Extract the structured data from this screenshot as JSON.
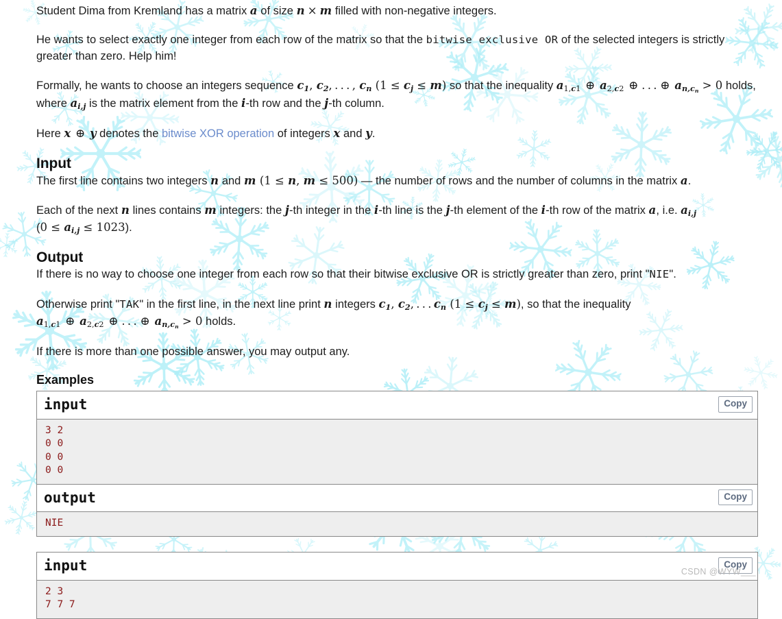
{
  "colors": {
    "link": "#6b8ccc",
    "code_text": "#8b1a1a",
    "code_bg": "#eeeeee",
    "box_border": "#888888",
    "snowflake": "#aeeef7",
    "watermark": "#b9b9b9"
  },
  "statement": {
    "p1": {
      "t1": "Student Dima from Kremland has a matrix ",
      "m1": "a",
      "t2": " of size ",
      "m2": "n",
      "m3": "×",
      "m4": "m",
      "t3": " filled with non-negative integers."
    },
    "p2": {
      "t1": "He wants to select exactly one integer from each row of the matrix so that the ",
      "code": "bitwise exclusive OR",
      "t2": " of the selected integers is strictly greater than zero. Help him!"
    },
    "p3": {
      "t1": "Formally, he wants to choose an integers sequence ",
      "seq": "c1, c2, . . . , cn",
      "range": "(1 ≤ cj ≤ m)",
      "t2": " so that the inequality ",
      "ineq": "a1,c1 ⊕ a2,c2 ⊕ . . . ⊕ an,cn > 0",
      "t3": " holds, where ",
      "m1": "ai,j",
      "t4": " is the matrix element from the ",
      "m2": "i",
      "t5": "-th row and the ",
      "m3": "j",
      "t6": "-th column."
    },
    "p4": {
      "t1": "Here ",
      "m1": "x ⊕ y",
      "t2": " denotes the ",
      "link": "bitwise XOR operation",
      "t3": " of integers ",
      "m2": "x",
      "t4": " and ",
      "m3": "y",
      "t5": "."
    }
  },
  "input_section": {
    "heading": "Input",
    "p1": {
      "t1": "The first line contains two integers ",
      "m1": "n",
      "t2": " and ",
      "m2": "m",
      "range": "(1 ≤ n, m ≤ 500)",
      "t3": " — the number of rows and the number of columns in the matrix ",
      "m3": "a",
      "t4": "."
    },
    "p2": {
      "t1": "Each of the next ",
      "m1": "n",
      "t2": " lines contains ",
      "m2": "m",
      "t3": " integers: the ",
      "m3": "j",
      "t4": "-th integer in the ",
      "m4": "i",
      "t5": "-th line is the ",
      "m5": "j",
      "t6": "-th element of the ",
      "m6": "i",
      "t7": "-th row of the matrix ",
      "m7": "a",
      "t8": ", i.e. ",
      "m8": "ai,j",
      "t9": " (",
      "range": "0 ≤ ai,j ≤ 1023",
      "t10": ")."
    }
  },
  "output_section": {
    "heading": "Output",
    "p1": {
      "t1": "If there is no way to choose one integer from each row so that their bitwise exclusive OR is strictly greater than zero, print \"",
      "code": "NIE",
      "t2": "\"."
    },
    "p2": {
      "t1": "Otherwise print \"",
      "code": "TAK",
      "t2": "\" in the first line, in the next line print ",
      "m1": "n",
      "t3": " integers ",
      "seq": "c1, c2, . . . cn",
      "range": "(1 ≤ cj ≤ m)",
      "t4": ", so that the inequality ",
      "ineq": "a1,c1 ⊕ a2,c2 ⊕ . . . ⊕ an,cn > 0",
      "t5": " holds."
    },
    "p3": "If there is more than one possible answer, you may output any."
  },
  "examples": {
    "heading": "Examples",
    "copy_label": "Copy",
    "items": [
      {
        "input_label": "input",
        "input_text": "3 2\n0 0\n0 0\n0 0",
        "output_label": "output",
        "output_text": "NIE"
      },
      {
        "input_label": "input",
        "input_text": "2 3\n7 7 7"
      }
    ]
  },
  "watermark": "CSDN @WYW___"
}
